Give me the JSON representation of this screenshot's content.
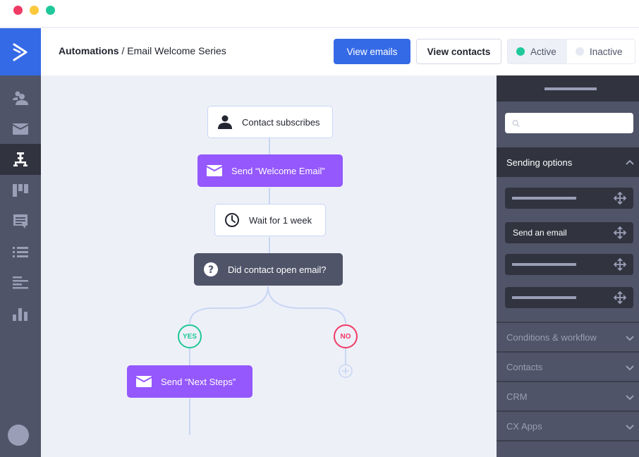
{
  "window": {
    "controls": [
      {
        "name": "close",
        "color": "#ef3a64"
      },
      {
        "name": "minimize",
        "color": "#fcc93d"
      },
      {
        "name": "maximize",
        "color": "#1fc89a"
      }
    ]
  },
  "rail": {
    "logo_icon": "activecampaign-chevron-logo",
    "items": [
      {
        "name": "contacts",
        "icon": "contacts-icon",
        "active": false
      },
      {
        "name": "campaigns",
        "icon": "envelope-icon",
        "active": false
      },
      {
        "name": "automations",
        "icon": "workflow-icon",
        "active": true
      },
      {
        "name": "deals",
        "icon": "pipeline-icon",
        "active": false
      },
      {
        "name": "conversations",
        "icon": "chat-icon",
        "active": false
      },
      {
        "name": "lists",
        "icon": "list-icon",
        "active": false
      },
      {
        "name": "site",
        "icon": "align-left-icon",
        "active": false
      },
      {
        "name": "reports",
        "icon": "bar-chart-icon",
        "active": false
      }
    ]
  },
  "header": {
    "breadcrumb_root": "Automations",
    "breadcrumb_sep": " / ",
    "breadcrumb_current": "Email Welcome Series",
    "view_emails_label": "View emails",
    "view_contacts_label": "View contacts",
    "status_toggle": {
      "active_label": "Active",
      "inactive_label": "Inactive",
      "selected": "Active",
      "active_color": "#1fc89a",
      "inactive_color": "#e6e9f2"
    }
  },
  "canvas": {
    "nodes": [
      {
        "type": "trigger",
        "icon": "person-icon",
        "label": "Contact subscribes"
      },
      {
        "type": "action",
        "icon": "envelope-icon",
        "label": "Send “Welcome Email”"
      },
      {
        "type": "wait",
        "icon": "clock-icon",
        "label": "Wait for 1 week"
      },
      {
        "type": "condition",
        "icon": "question-icon",
        "label": "Did contact open email?"
      },
      {
        "type": "action",
        "icon": "envelope-icon",
        "label": "Send “Next Steps”"
      }
    ],
    "branches": {
      "yes_label": "YES",
      "no_label": "NO",
      "yes_color": "#1fc89a",
      "no_color": "#ef3a64"
    },
    "colors": {
      "action": "#9458fc",
      "condition": "#4f5468",
      "connector": "#c8d6f4"
    }
  },
  "panel": {
    "search_placeholder": "",
    "sections": [
      {
        "label": "Sending options",
        "expanded": true,
        "actions": [
          {
            "label": ""
          },
          {
            "label": "Send an email"
          },
          {
            "label": ""
          },
          {
            "label": ""
          }
        ]
      },
      {
        "label": "Conditions & workflow",
        "expanded": false
      },
      {
        "label": "Contacts",
        "expanded": false
      },
      {
        "label": "CRM",
        "expanded": false
      },
      {
        "label": "CX Apps",
        "expanded": false
      }
    ]
  }
}
